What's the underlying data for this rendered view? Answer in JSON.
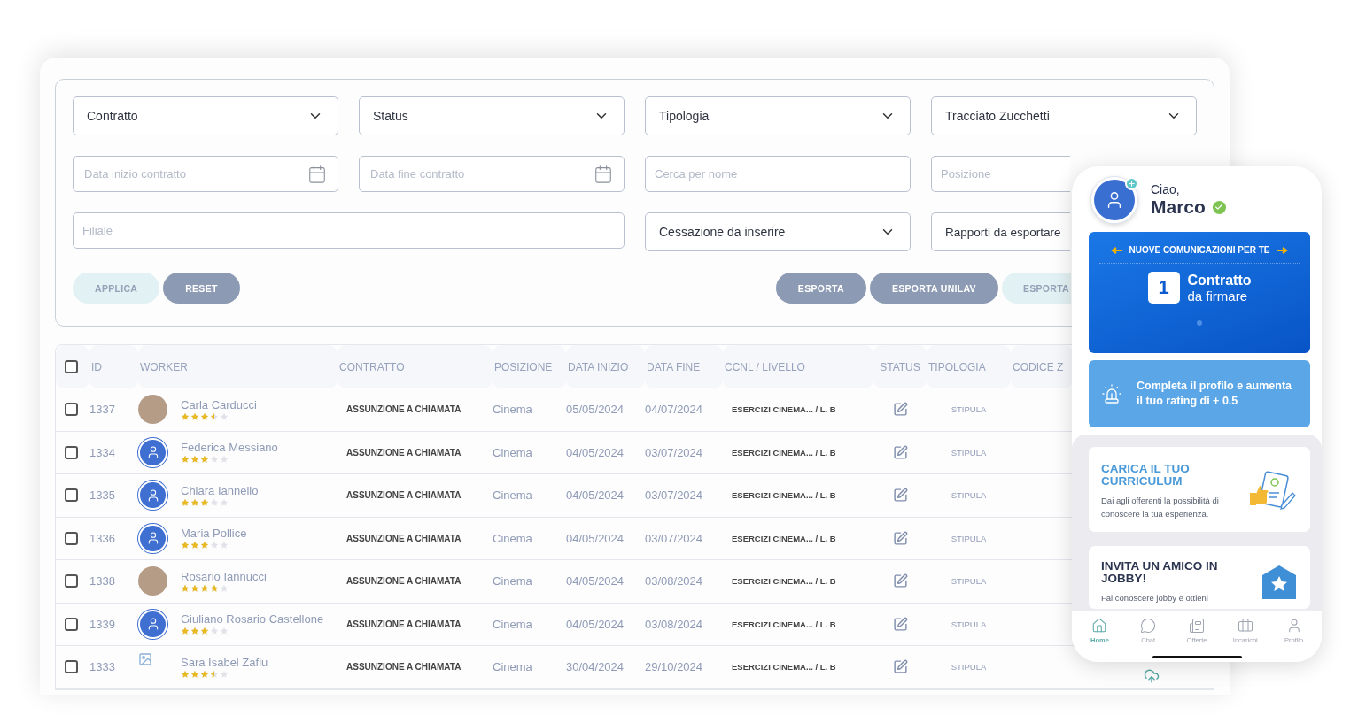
{
  "filters": [
    {
      "kind": "select",
      "label": "Contratto"
    },
    {
      "kind": "select",
      "label": "Status"
    },
    {
      "kind": "select",
      "label": "Tipologia"
    },
    {
      "kind": "select",
      "label": "Tracciato Zucchetti"
    },
    {
      "kind": "date",
      "placeholder": "Data inizio contratto"
    },
    {
      "kind": "date",
      "placeholder": "Data fine contratto"
    },
    {
      "kind": "text",
      "placeholder": "Cerca per nome"
    },
    {
      "kind": "text",
      "placeholder": "Posizione"
    },
    {
      "kind": "wide_text",
      "placeholder": "Filiale"
    },
    {
      "kind": "select",
      "label": "Cessazione da inserire"
    },
    {
      "kind": "select",
      "label": "Rapporti da esportare"
    }
  ],
  "left_buttons": [
    {
      "label": "APPLICA",
      "kind": "light"
    },
    {
      "label": "RESET",
      "kind": "dark"
    }
  ],
  "right_buttons": [
    {
      "label": "ESPORTA",
      "kind": "dark"
    },
    {
      "label": "ESPORTA UNILAV",
      "kind": "dark"
    },
    {
      "label": "ESPORTA",
      "kind": "light"
    }
  ],
  "table": {
    "all_checked": false,
    "columns": [
      "ID",
      "WORKER",
      "CONTRATTO",
      "POSIZIONE",
      "DATA INIZIO",
      "DATA FINE",
      "CCNL / LIVELLO",
      "STATUS",
      "TIPOLOGIA",
      "CODICE Z"
    ],
    "rows": [
      {
        "checked": false,
        "id": "1337",
        "kind": "photo",
        "name": "Carla Carducci",
        "stars": 3.5,
        "contract": "ASSUNZIONE A CHIAMATA",
        "position": "Cinema",
        "start": "05/05/2024",
        "end": "04/07/2024",
        "ccnl": "ESERCIZI CINEMA... / L. B",
        "type": "STIPULA",
        "upload": false
      },
      {
        "checked": false,
        "id": "1334",
        "kind": "user",
        "name": "Federica Messiano",
        "stars": 3,
        "contract": "ASSUNZIONE A CHIAMATA",
        "position": "Cinema",
        "start": "04/05/2024",
        "end": "03/07/2024",
        "ccnl": "ESERCIZI CINEMA... / L. B",
        "type": "STIPULA",
        "upload": false
      },
      {
        "checked": false,
        "id": "1335",
        "kind": "user",
        "name": "Chiara Iannello",
        "stars": 3,
        "contract": "ASSUNZIONE A CHIAMATA",
        "position": "Cinema",
        "start": "04/05/2024",
        "end": "03/07/2024",
        "ccnl": "ESERCIZI CINEMA... / L. B",
        "type": "STIPULA",
        "upload": false
      },
      {
        "checked": false,
        "id": "1336",
        "kind": "user",
        "name": "Maria Pollice",
        "stars": 3,
        "contract": "ASSUNZIONE A CHIAMATA",
        "position": "Cinema",
        "start": "04/05/2024",
        "end": "03/07/2024",
        "ccnl": "ESERCIZI CINEMA... / L. B",
        "type": "STIPULA",
        "upload": false
      },
      {
        "checked": false,
        "id": "1338",
        "kind": "photo",
        "name": "Rosario Iannucci",
        "stars": 4,
        "contract": "ASSUNZIONE A CHIAMATA",
        "position": "Cinema",
        "start": "04/05/2024",
        "end": "03/08/2024",
        "ccnl": "ESERCIZI CINEMA... / L. B",
        "type": "STIPULA",
        "upload": false
      },
      {
        "checked": false,
        "id": "1339",
        "kind": "user",
        "name": "Giuliano Rosario Castellone",
        "stars": 3,
        "contract": "ASSUNZIONE A CHIAMATA",
        "position": "Cinema",
        "start": "04/05/2024",
        "end": "03/08/2024",
        "ccnl": "ESERCIZI CINEMA... / L. B",
        "type": "STIPULA",
        "upload": false
      },
      {
        "checked": false,
        "id": "1333",
        "kind": "broken",
        "name": "Sara Isabel Zafiu",
        "stars": 3.5,
        "contract": "ASSUNZIONE A CHIAMATA",
        "position": "Cinema",
        "start": "30/04/2024",
        "end": "29/10/2024",
        "ccnl": "ESERCIZI CINEMA... / L. B",
        "type": "STIPULA",
        "upload": true
      }
    ]
  },
  "phone": {
    "greeting": "Ciao,",
    "name": "Marco",
    "banner": {
      "title": "NUOVE COMUNICAZIONI PER TE",
      "count": "1",
      "line1": "Contratto",
      "line2": "da firmare"
    },
    "promo": "Completa il profilo e aumenta il tuo rating di + 0.5",
    "cards": [
      {
        "kind": "curriculum",
        "title": "CARICA IL TUO CURRICULUM",
        "text": "Dai agli offerenti la possibilità di conoscere la tua esperienza."
      },
      {
        "kind": "invite",
        "title": "INVITA UN AMICO IN JOBBY!",
        "text": "Fai conoscere jobby e ottieni"
      }
    ],
    "tabs": [
      {
        "kind": "home",
        "label": "Home",
        "selected": true
      },
      {
        "kind": "chat",
        "label": "Chat",
        "selected": false
      },
      {
        "kind": "offers",
        "label": "Offerte",
        "selected": false
      },
      {
        "kind": "tasks",
        "label": "Incarichi",
        "selected": false
      },
      {
        "kind": "profile",
        "label": "Profilo",
        "selected": false
      }
    ]
  }
}
